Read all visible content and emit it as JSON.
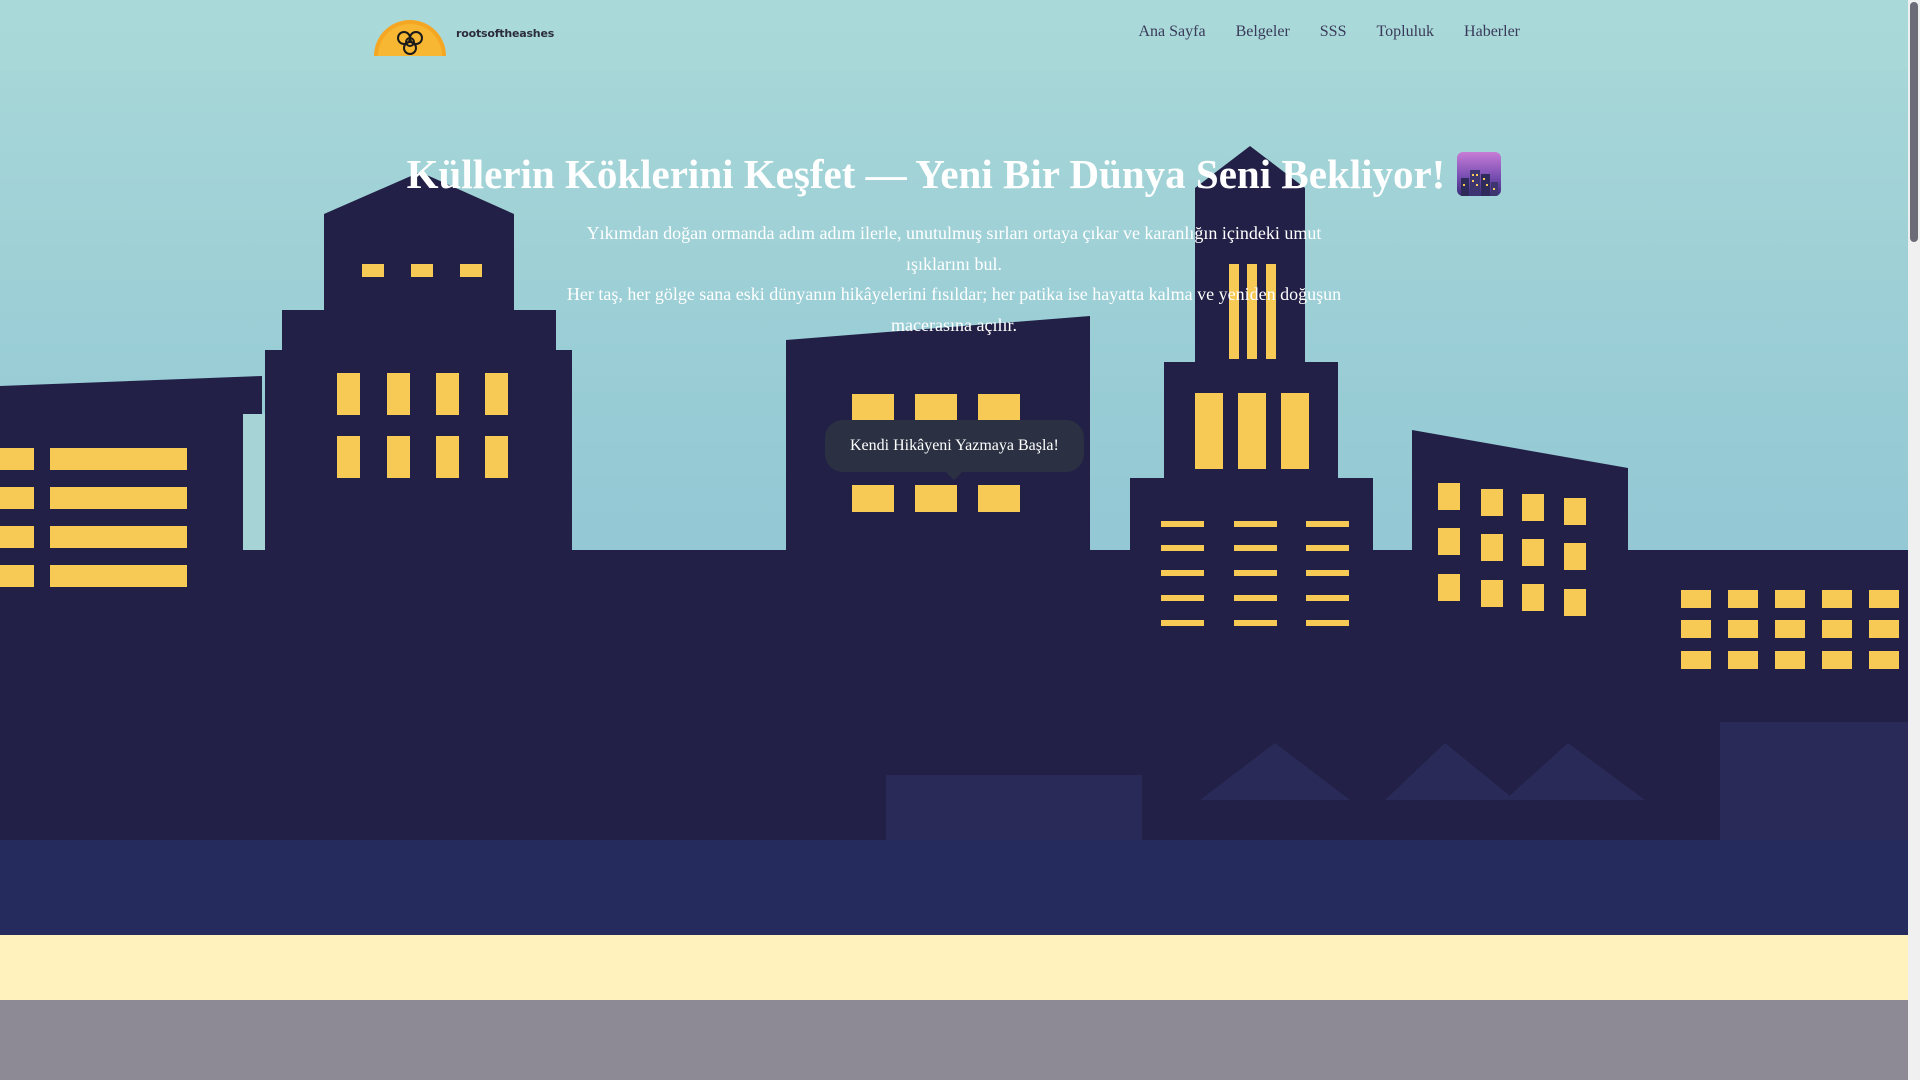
{
  "header": {
    "logo_text": "rootsoftheashes",
    "nav": [
      {
        "label": "Ana Sayfa"
      },
      {
        "label": "Belgeler"
      },
      {
        "label": "SSS"
      },
      {
        "label": "Topluluk"
      },
      {
        "label": "Haberler"
      }
    ]
  },
  "hero": {
    "title": "Küllerin Köklerini Keşfet — Yeni Bir Dünya Seni Bekliyor!",
    "title_icon": "cityscape-dusk-icon",
    "description_line1": "Yıkımdan doğan ormanda adım adım ilerle, unutulmuş sırları ortaya çıkar ve karanlığın içindeki umut ışıklarını bul.",
    "description_line2": "Her taş, her gölge sana eski dünyanın hikâyelerini fısıldar; her patika ise hayatta kalma ve yeniden doğuşun macerasına açılır.",
    "cta_label": "Kendi Hikâyeni Yazmaya Başla!"
  },
  "colors": {
    "sky": "#97cbd5",
    "buildings": "#222046",
    "windows": "#f7ca56",
    "ground": "#262b5e",
    "sand": "#fff2bd",
    "road": "#8e8a95",
    "button": "#2b3143"
  }
}
